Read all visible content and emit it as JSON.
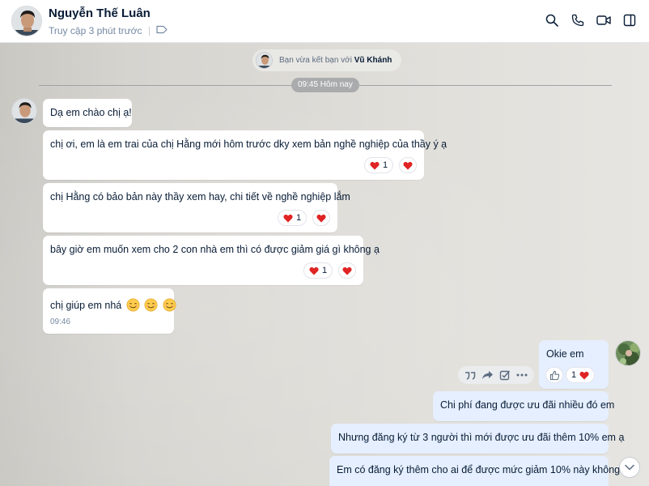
{
  "header": {
    "contact_name": "Nguyễn Thế Luân",
    "status_text": "Truy cập 3 phút trước",
    "icons": [
      "tag-icon",
      "search-icon",
      "phone-icon",
      "video-call-icon",
      "sidebar-toggle-icon"
    ]
  },
  "system": {
    "friend_prefix": "Bạn vừa kết bạn với",
    "friend_name": "Vũ Khánh",
    "time_divider": "09:45 Hôm nay"
  },
  "messages": [
    {
      "text": "Dạ em chào chị ạ!"
    },
    {
      "text": "chị ơi, em là em trai của chị Hằng mới hôm trước dky xem bản nghề nghiệp của thầy ý ạ",
      "reaction_count": "1"
    },
    {
      "text": "chị Hằng có bảo bản này thầy xem hay, chi tiết về nghề nghiệp lắm",
      "reaction_count": "1"
    },
    {
      "text": "bây giờ em muốn xem cho 2 con nhà em thì có được giảm giá gì không ạ",
      "reaction_count": "1"
    },
    {
      "text": "chị giúp em nhá",
      "emojis": [
        "smiling-face-emoji",
        "smiling-face-emoji",
        "smiling-face-emoji"
      ],
      "time": "09:46"
    }
  ],
  "my_messages": [
    {
      "text": "Okie em",
      "reaction_count": "1"
    },
    {
      "text": "Chi phí đang được ưu đãi nhiều đó em"
    },
    {
      "text": "Nhưng đăng ký từ 3 người thì mới được ưu đãi thêm 10% em ạ"
    },
    {
      "text": "Em có đăng ký thêm cho ai để được mức giảm 10% này không?"
    }
  ],
  "colors": {
    "my_bubble": "#e5efff",
    "their_bubble": "#ffffff",
    "heart": "#e02424",
    "text": "#081c36",
    "muted": "#7589a3"
  }
}
